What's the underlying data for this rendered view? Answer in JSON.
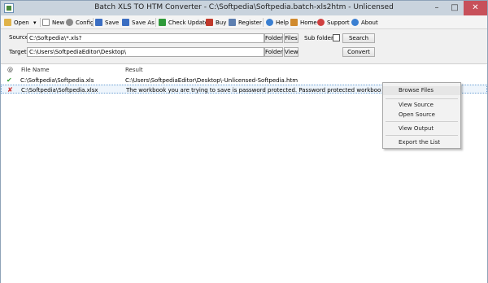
{
  "window": {
    "title": "Batch XLS TO HTM Converter - C:\\Softpedia\\Softpedia.batch-xls2htm - Unlicensed",
    "minimize": "–",
    "maximize": "□",
    "close": "✕"
  },
  "toolbar": {
    "open": "Open",
    "open_dropdown": "▾",
    "new": "New",
    "config": "Config",
    "save": "Save",
    "save_as": "Save As",
    "check_update": "Check Update",
    "buy": "Buy",
    "register": "Register",
    "help": "Help",
    "home": "Home",
    "support": "Support",
    "about": "About",
    "icon_colors": {
      "open": "#e0b34a",
      "new": "#ffffff",
      "config": "#8a8a8a",
      "save": "#3b6ec2",
      "save_as": "#3b6ec2",
      "check_update": "#2f9a3a",
      "buy": "#c0392b",
      "register": "#5d7fb0",
      "help": "#3a7fd1",
      "home": "#d08a2e",
      "support": "#d04040",
      "about": "#3a7fd1"
    }
  },
  "form": {
    "source_label": "Source",
    "source_value": "C:\\Softpedia\\*.xls?",
    "folder_button": "Folder",
    "files_button": "Files",
    "subfolders_label": "Sub folders",
    "search_button": "Search",
    "target_label": "Target",
    "target_value": "C:\\Users\\SoftpediaEditor\\Desktop\\",
    "target_folder_button": "Folder",
    "view_button": "View",
    "convert_button": "Convert"
  },
  "list": {
    "columns": {
      "status": "@",
      "file_name": "File Name",
      "result": "Result"
    },
    "rows": [
      {
        "status_glyph": "✔",
        "status_color": "#2e9a2e",
        "file": "C:\\Softpedia\\Softpedia.xls",
        "result": "C:\\Users\\SoftpediaEditor\\Desktop\\-Unlicensed-Softpedia.htm"
      },
      {
        "status_glyph": "✘",
        "status_color": "#d03030",
        "file": "C:\\Softpedia\\Softpedia.xlsx",
        "result": "The workbook you are trying to save is password protected.  Password protected workbooks cannot be saved..."
      }
    ]
  },
  "context_menu": {
    "browse_files": "Browse Files",
    "view_source": "View  Source",
    "open_source": "Open Source",
    "view_output": "View  Output",
    "export_list": "Export the List"
  }
}
